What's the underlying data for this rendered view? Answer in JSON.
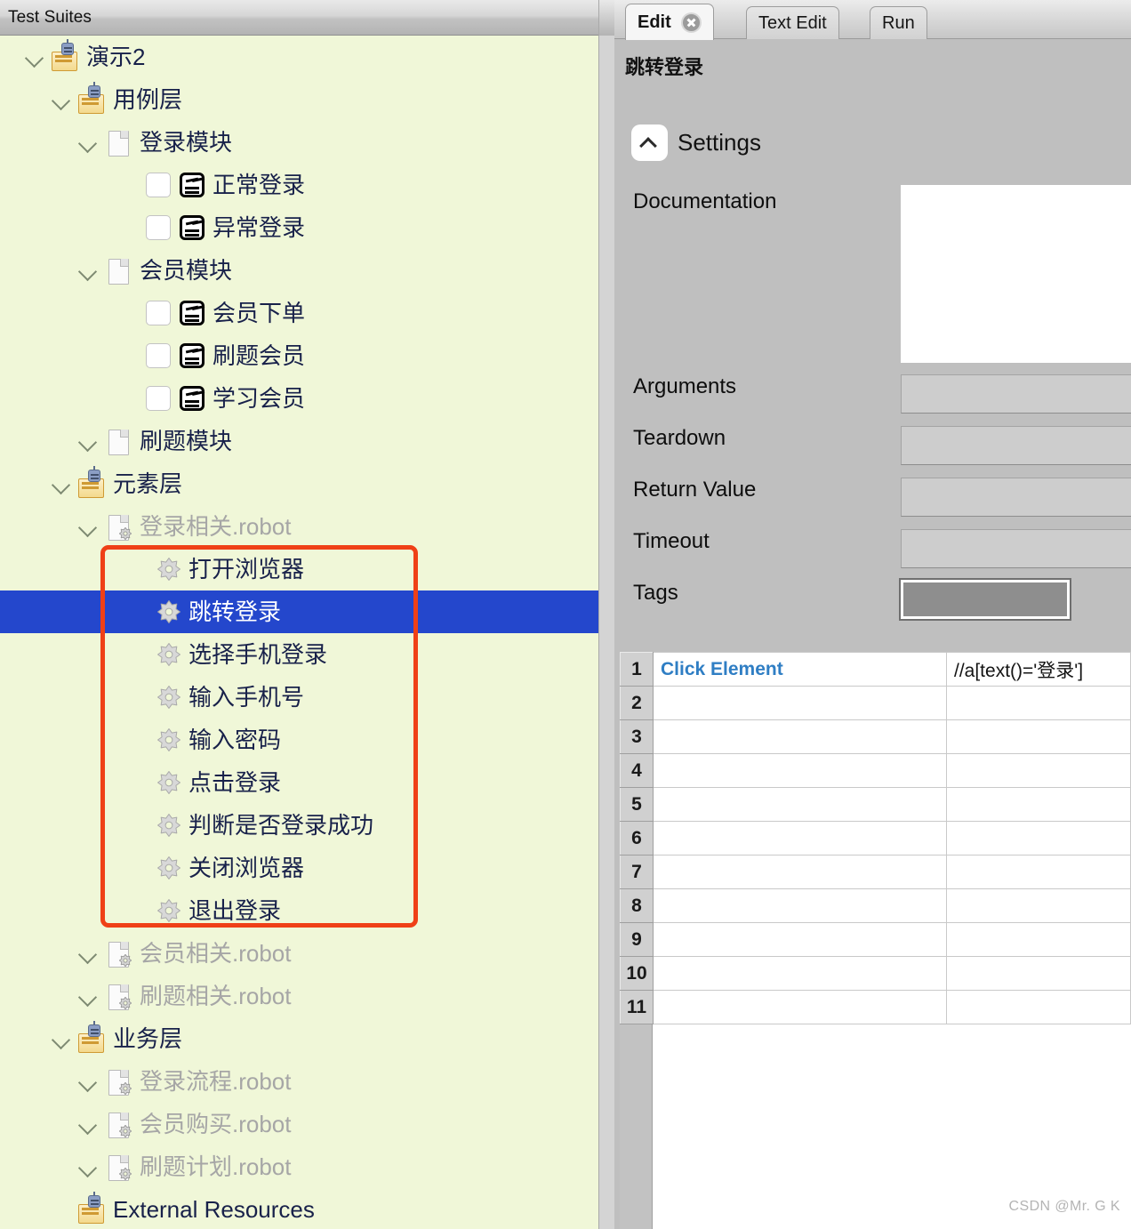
{
  "tree": {
    "header_title": "Test Suites",
    "items": [
      {
        "label": "演示2",
        "indent": 22,
        "icon": "suite-folder-icon",
        "chevron": "down",
        "dim": false
      },
      {
        "label": "用例层",
        "indent": 52,
        "icon": "suite-folder-icon",
        "chevron": "down",
        "dim": false
      },
      {
        "label": "登录模块",
        "indent": 82,
        "icon": "file-icon",
        "chevron": "down",
        "dim": false
      },
      {
        "label": "正常登录",
        "indent": 130,
        "icon": "testcase-robot-icon",
        "chevron": "none",
        "checkbox": true,
        "dim": false
      },
      {
        "label": "异常登录",
        "indent": 130,
        "icon": "testcase-robot-icon",
        "chevron": "none",
        "checkbox": true,
        "dim": false
      },
      {
        "label": "会员模块",
        "indent": 82,
        "icon": "file-icon",
        "chevron": "down",
        "dim": false
      },
      {
        "label": "会员下单",
        "indent": 130,
        "icon": "testcase-robot-icon",
        "chevron": "none",
        "checkbox": true,
        "dim": false
      },
      {
        "label": "刷题会员",
        "indent": 130,
        "icon": "testcase-robot-icon",
        "chevron": "none",
        "checkbox": true,
        "dim": false
      },
      {
        "label": "学习会员",
        "indent": 130,
        "icon": "testcase-robot-icon",
        "chevron": "none",
        "checkbox": true,
        "dim": false
      },
      {
        "label": "刷题模块",
        "indent": 82,
        "icon": "file-icon",
        "chevron": "down",
        "dim": false
      },
      {
        "label": "元素层",
        "indent": 52,
        "icon": "suite-folder-icon",
        "chevron": "down",
        "dim": false
      },
      {
        "label": "登录相关.robot",
        "indent": 82,
        "icon": "resource-file-icon",
        "chevron": "down",
        "dim": true
      },
      {
        "label": "打开浏览器",
        "indent": 140,
        "icon": "keyword-gear-icon",
        "chevron": "none",
        "dim": false
      },
      {
        "label": "跳转登录",
        "indent": 140,
        "icon": "keyword-gear-icon",
        "chevron": "none",
        "dim": false,
        "selected": true
      },
      {
        "label": "选择手机登录",
        "indent": 140,
        "icon": "keyword-gear-icon",
        "chevron": "none",
        "dim": false
      },
      {
        "label": "输入手机号",
        "indent": 140,
        "icon": "keyword-gear-icon",
        "chevron": "none",
        "dim": false
      },
      {
        "label": "输入密码",
        "indent": 140,
        "icon": "keyword-gear-icon",
        "chevron": "none",
        "dim": false
      },
      {
        "label": "点击登录",
        "indent": 140,
        "icon": "keyword-gear-icon",
        "chevron": "none",
        "dim": false
      },
      {
        "label": "判断是否登录成功",
        "indent": 140,
        "icon": "keyword-gear-icon",
        "chevron": "none",
        "dim": false
      },
      {
        "label": "关闭浏览器",
        "indent": 140,
        "icon": "keyword-gear-icon",
        "chevron": "none",
        "dim": false
      },
      {
        "label": "退出登录",
        "indent": 140,
        "icon": "keyword-gear-icon",
        "chevron": "none",
        "dim": false
      },
      {
        "label": "会员相关.robot",
        "indent": 82,
        "icon": "resource-file-icon",
        "chevron": "down",
        "dim": true
      },
      {
        "label": "刷题相关.robot",
        "indent": 82,
        "icon": "resource-file-icon",
        "chevron": "down",
        "dim": true
      },
      {
        "label": "业务层",
        "indent": 52,
        "icon": "suite-folder-icon",
        "chevron": "down",
        "dim": false
      },
      {
        "label": "登录流程.robot",
        "indent": 82,
        "icon": "resource-file-icon",
        "chevron": "down",
        "dim": true
      },
      {
        "label": "会员购买.robot",
        "indent": 82,
        "icon": "resource-file-icon",
        "chevron": "down",
        "dim": true
      },
      {
        "label": "刷题计划.robot",
        "indent": 82,
        "icon": "resource-file-icon",
        "chevron": "down",
        "dim": true
      },
      {
        "label": "External Resources",
        "indent": 52,
        "icon": "suite-folder-icon",
        "chevron": "none",
        "dim": false
      }
    ],
    "highlight_box_color": "#ef4017",
    "selection_color": "#2447cc",
    "background_color": "#f0f7d8"
  },
  "editor": {
    "tabs": [
      {
        "label": "Edit",
        "active": true,
        "closable": true
      },
      {
        "label": "Text Edit",
        "active": false,
        "closable": false
      },
      {
        "label": "Run",
        "active": false,
        "closable": false
      }
    ],
    "keyword_name": "跳转登录",
    "settings": {
      "toggle_label": "Settings",
      "toggle_state": "expanded",
      "fields": [
        {
          "label": "Documentation",
          "value": "",
          "type": "textarea"
        },
        {
          "label": "Arguments",
          "value": "",
          "type": "text"
        },
        {
          "label": "Teardown",
          "value": "",
          "type": "text"
        },
        {
          "label": "Return Value",
          "value": "",
          "type": "text"
        },
        {
          "label": "Timeout",
          "value": "",
          "type": "text"
        },
        {
          "label": "Tags",
          "value": "",
          "type": "text",
          "focused": true
        }
      ]
    },
    "steps": {
      "rows": [
        {
          "num": "1",
          "keyword": "Click Element",
          "arg": "//a[text()='登录']"
        },
        {
          "num": "2",
          "keyword": "",
          "arg": ""
        },
        {
          "num": "3",
          "keyword": "",
          "arg": ""
        },
        {
          "num": "4",
          "keyword": "",
          "arg": ""
        },
        {
          "num": "5",
          "keyword": "",
          "arg": ""
        },
        {
          "num": "6",
          "keyword": "",
          "arg": ""
        },
        {
          "num": "7",
          "keyword": "",
          "arg": ""
        },
        {
          "num": "8",
          "keyword": "",
          "arg": ""
        },
        {
          "num": "9",
          "keyword": "",
          "arg": ""
        },
        {
          "num": "10",
          "keyword": "",
          "arg": ""
        },
        {
          "num": "11",
          "keyword": "",
          "arg": ""
        }
      ],
      "keyword_color": "#2f7ec4"
    }
  },
  "watermark": "CSDN @Mr. G K"
}
